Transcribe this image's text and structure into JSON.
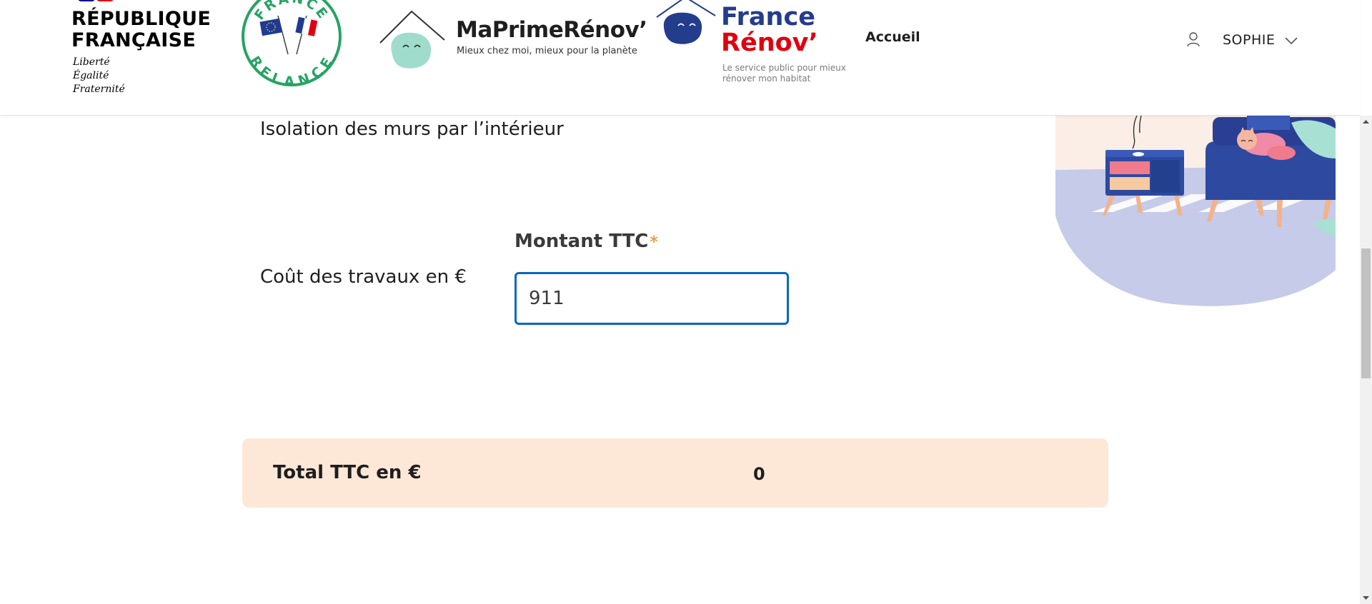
{
  "header": {
    "republic": {
      "line1": "RÉPUBLIQUE",
      "line2": "FRANÇAISE"
    },
    "motto": {
      "line1": "Liberté",
      "line2": "Égalité",
      "line3": "Fraternité"
    },
    "relance_logo": {
      "top": "FRANCE",
      "bottom": "RELANCE"
    },
    "maprimerenov": {
      "name": "MaPrimeRénov’",
      "tagline": "Mieux chez moi, mieux pour la planète"
    },
    "france_renov": {
      "line1": "France",
      "line2": "Rénov’",
      "tagline": "Le service public pour mieux rénover mon habitat"
    },
    "nav": {
      "home": "Accueil"
    },
    "user": {
      "name": "SOPHIE",
      "icon": "user-icon",
      "menu_icon": "chevron-down-icon"
    }
  },
  "form": {
    "section_title": "Isolation des murs par l’intérieur",
    "cost_label": "Coût des travaux en €",
    "amount_label": "Montant TTC",
    "required_mark": "*",
    "amount_value": "911"
  },
  "total": {
    "label": "Total TTC en €",
    "value": "0"
  },
  "colors": {
    "rf_blue": "#000091",
    "rf_red": "#e1000f",
    "relance_green": "#27a363",
    "input_border": "#0a66c2",
    "total_bg": "#fde8d7",
    "required_star": "#e8a04a",
    "illustration_blob": "#c5cbe8"
  }
}
